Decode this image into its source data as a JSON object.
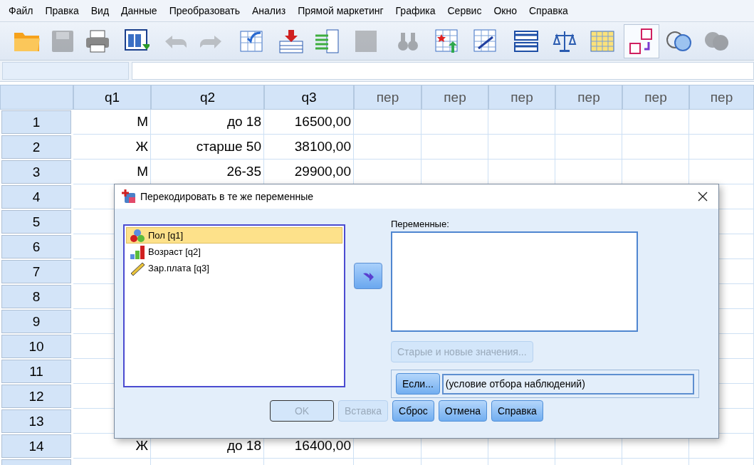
{
  "menu": [
    "Файл",
    "Правка",
    "Вид",
    "Данные",
    "Преобразовать",
    "Анализ",
    "Прямой маркетинг",
    "Графика",
    "Сервис",
    "Окно",
    "Справка"
  ],
  "toolbar": [
    {
      "kind": "folder",
      "disabled": false
    },
    {
      "kind": "disk",
      "disabled": true
    },
    {
      "kind": "printer",
      "disabled": false
    },
    {
      "kind": "recall",
      "disabled": false
    },
    {
      "kind": "undo",
      "disabled": true
    },
    {
      "kind": "redo",
      "disabled": true
    },
    {
      "kind": "goto",
      "disabled": false
    },
    {
      "kind": "insert-case",
      "disabled": false
    },
    {
      "kind": "insert-var",
      "disabled": false
    },
    {
      "kind": "split",
      "disabled": true
    },
    {
      "kind": "find",
      "disabled": true
    },
    {
      "kind": "star-table",
      "disabled": false
    },
    {
      "kind": "select-cases",
      "disabled": false
    },
    {
      "kind": "grid",
      "disabled": false
    },
    {
      "kind": "scales",
      "disabled": false
    },
    {
      "kind": "value-table",
      "disabled": false
    },
    {
      "kind": "labels",
      "disabled": false,
      "selected": true
    },
    {
      "kind": "circles",
      "disabled": false
    },
    {
      "kind": "filled-circles",
      "disabled": true
    }
  ],
  "grid": {
    "columns": [
      "q1",
      "q2",
      "q3",
      "пер",
      "пер",
      "пер",
      "пер",
      "пер",
      "пер"
    ],
    "rows": [
      {
        "number": "1",
        "cells": [
          "М",
          "до 18",
          "16500,00"
        ]
      },
      {
        "number": "2",
        "cells": [
          "Ж",
          "старше 50",
          "38100,00"
        ]
      },
      {
        "number": "3",
        "cells": [
          "М",
          "26-35",
          "29900,00"
        ]
      },
      {
        "number": "4",
        "cells": []
      },
      {
        "number": "5",
        "cells": []
      },
      {
        "number": "6",
        "cells": []
      },
      {
        "number": "7",
        "cells": []
      },
      {
        "number": "8",
        "cells": []
      },
      {
        "number": "9",
        "cells": []
      },
      {
        "number": "10",
        "cells": []
      },
      {
        "number": "11",
        "cells": []
      },
      {
        "number": "12",
        "cells": []
      },
      {
        "number": "13",
        "cells": []
      },
      {
        "number": "14",
        "cells": [
          "Ж",
          "до 18",
          "16400,00"
        ]
      }
    ]
  },
  "dialog": {
    "title": "Перекодировать в те же переменные",
    "source_list": [
      {
        "label": "Пол [q1]",
        "kind": "nominal",
        "selected": true
      },
      {
        "label": "Возраст [q2]",
        "kind": "ordinal",
        "selected": false
      },
      {
        "label": "Зар.плата [q3]",
        "kind": "scale",
        "selected": false
      }
    ],
    "variables_label": "Переменные:",
    "old_new_button": {
      "label": "Старые и новые значения...",
      "disabled": true
    },
    "if_button": "Если...",
    "if_condition": "(условие отбора наблюдений)",
    "buttons": [
      {
        "label": "OK",
        "disabled": true
      },
      {
        "label": "Вставка",
        "disabled": true
      },
      {
        "label": "Сброс",
        "disabled": false
      },
      {
        "label": "Отмена",
        "disabled": false
      },
      {
        "label": "Справка",
        "disabled": false
      }
    ]
  }
}
